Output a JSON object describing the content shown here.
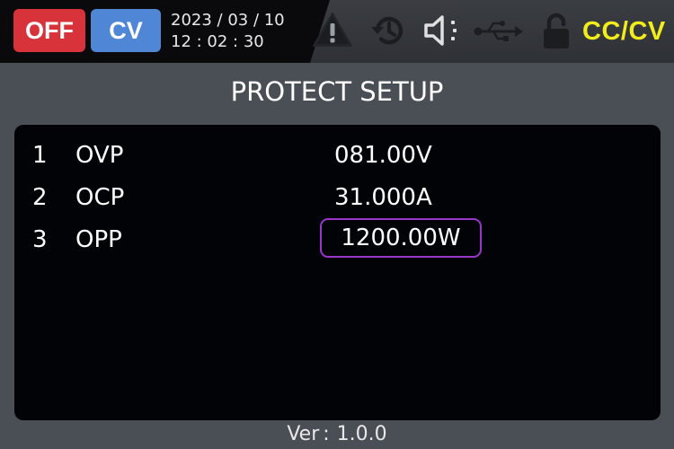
{
  "status_bar": {
    "output_state": "OFF",
    "regulation_mode": "CV",
    "date": "2023 / 03 / 10",
    "time": "12 : 02 : 30",
    "mode_label": "CC/CV",
    "icons": [
      "warning-icon",
      "history-icon",
      "speaker-icon",
      "usb-icon",
      "lock-icon"
    ],
    "colors": {
      "off_badge": "#d8333a",
      "cv_badge": "#4f86d6",
      "mode_label": "#f2ec1d"
    }
  },
  "page": {
    "title": "PROTECT SETUP"
  },
  "settings": [
    {
      "index": "1",
      "name": "OVP",
      "value": "081.00V"
    },
    {
      "index": "2",
      "name": "OCP",
      "value": "31.000A"
    },
    {
      "index": "3",
      "name": "OPP",
      "value": "1200.00W"
    }
  ],
  "selected_setting": "OPP",
  "selection_color": "#9a35c8",
  "footer": {
    "version_label": "Ver",
    "version_separator": ":",
    "version": "1.0.0"
  }
}
